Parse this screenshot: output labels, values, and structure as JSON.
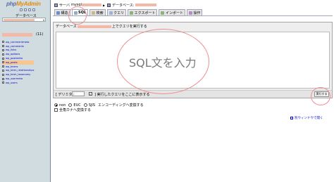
{
  "sidebar": {
    "logo_part1": "php",
    "logo_part2": "MyAdmin",
    "db_label": "データベース",
    "db_count": "(11)",
    "tables": [
      "wp_commentmeta",
      "wp_comments",
      "wp_links",
      "wp_options",
      "wp_postmeta",
      "wp_posts",
      "wp_terms",
      "wp_term_relationships",
      "wp_term_taxonomy",
      "wp_usermeta",
      "wp_users"
    ]
  },
  "breadcrumb": {
    "server_label": "サーバ",
    "server_value": "mysql",
    "database_label": "データベース:"
  },
  "tabs": [
    {
      "label": "構造"
    },
    {
      "label": "SQL"
    },
    {
      "label": "検索"
    },
    {
      "label": "クエリ"
    },
    {
      "label": "エクスポート"
    },
    {
      "label": "インポート"
    },
    {
      "label": "操作"
    }
  ],
  "sql_panel": {
    "title_prefix": "データベース",
    "title_suffix": "上でクエリを実行する",
    "overlay_text": "SQL文を入力",
    "delimiter_label": "[ デリミタ",
    "delimiter_value": ";",
    "show_query_label": "] 実行したクエリをここに表示する",
    "run_button": "実行する"
  },
  "encoding": {
    "options": [
      "non",
      "EUC",
      "SJIS"
    ],
    "selected": "non",
    "tail_label": "エンコーディングへ変換する",
    "kana_label": "全角カナへ変換する"
  },
  "new_window_link": "別ウィンドウで開く"
}
